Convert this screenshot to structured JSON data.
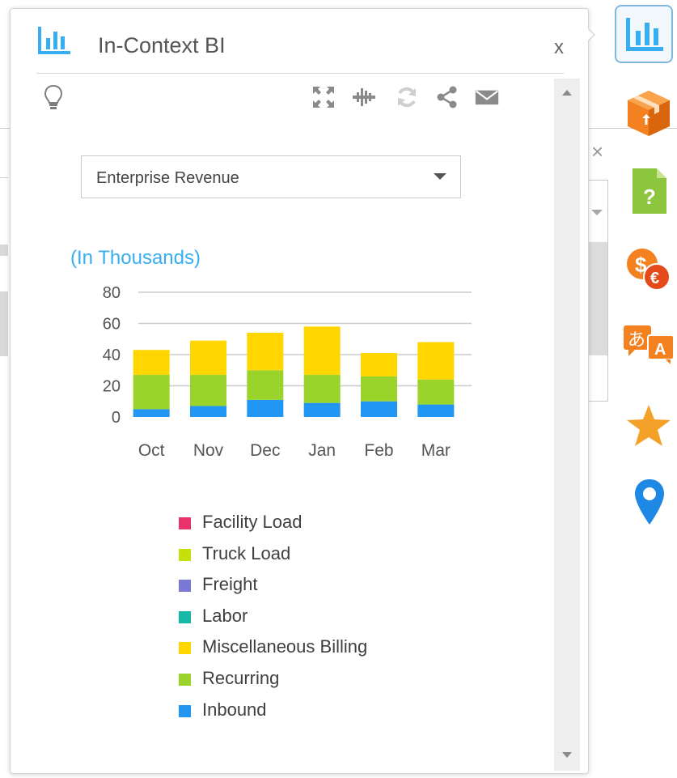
{
  "panel": {
    "title": "In-Context BI",
    "close_label": "x",
    "toolbar": {
      "icons": [
        "lightbulb-icon",
        "expand-icon",
        "waveform-icon",
        "refresh-icon",
        "share-icon",
        "email-icon"
      ]
    }
  },
  "report_select": {
    "selected": "Enterprise Revenue"
  },
  "units_label": "(In Thousands)",
  "chart_data": {
    "type": "bar",
    "stacked": true,
    "categories": [
      "Oct",
      "Nov",
      "Dec",
      "Jan",
      "Feb",
      "Mar"
    ],
    "y_ticks": [
      "0",
      "20",
      "40",
      "60",
      "80"
    ],
    "ylim": [
      0,
      80
    ],
    "grid": true,
    "series": [
      {
        "name": "Facility Load",
        "color": "#e8336a",
        "values": [
          0,
          0,
          0,
          0,
          0,
          0
        ]
      },
      {
        "name": "Truck Load",
        "color": "#c6e00c",
        "values": [
          0,
          0,
          0,
          0,
          0,
          0
        ]
      },
      {
        "name": "Freight",
        "color": "#7a7ad6",
        "values": [
          0,
          0,
          0,
          0,
          0,
          0
        ]
      },
      {
        "name": "Labor",
        "color": "#16b8a8",
        "values": [
          0,
          0,
          0,
          0,
          0,
          0
        ]
      },
      {
        "name": "Miscellaneous Billing",
        "color": "#ffd600",
        "values": [
          16,
          22,
          24,
          31,
          15,
          24
        ]
      },
      {
        "name": "Recurring",
        "color": "#9ad42a",
        "values": [
          22,
          20,
          19,
          18,
          16,
          16
        ]
      },
      {
        "name": "Inbound",
        "color": "#2196f3",
        "values": [
          5,
          7,
          11,
          9,
          10,
          8
        ]
      }
    ]
  },
  "legend": [
    {
      "label": "Facility Load",
      "color": "#e8336a"
    },
    {
      "label": "Truck Load",
      "color": "#c6e00c"
    },
    {
      "label": "Freight",
      "color": "#7a7ad6"
    },
    {
      "label": "Labor",
      "color": "#16b8a8"
    },
    {
      "label": "Miscellaneous Billing",
      "color": "#ffd600"
    },
    {
      "label": "Recurring",
      "color": "#9ad42a"
    },
    {
      "label": "Inbound",
      "color": "#2196f3"
    }
  ],
  "dock": {
    "items": [
      "bar-chart-icon",
      "package-icon",
      "help-document-icon",
      "currency-exchange-icon",
      "translate-icon",
      "star-icon",
      "location-pin-icon"
    ]
  },
  "colors": {
    "accent": "#38aef2",
    "dock_orange": "#f4811f",
    "dock_green": "#8cc63f",
    "dock_blue": "#1e88e5"
  }
}
